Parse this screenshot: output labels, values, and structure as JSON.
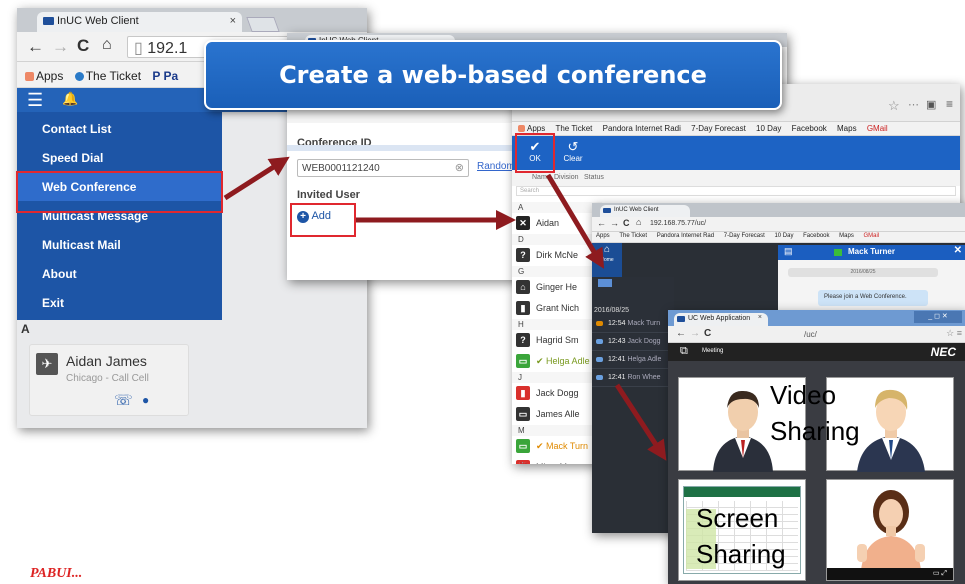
{
  "callout": {
    "title": "Create a web-based conference"
  },
  "window1": {
    "tab_title": "InUC Web Client",
    "tab_close": "×",
    "url": "192.1",
    "bookmarks": [
      "Apps",
      "The Ticket",
      "P Pa"
    ],
    "menu": [
      "Contact List",
      "Speed Dial",
      "Web Conference",
      "Multicast Message",
      "Multicast Mail",
      "About",
      "Exit"
    ],
    "section_letter": "A",
    "contact": {
      "name": "Aidan James",
      "location": "Chicago - Call Cell"
    }
  },
  "window2": {
    "tab_title": "InUC Web Client",
    "conference_id_label": "Conference ID",
    "conference_id_value": "WEB0001121240",
    "random_link": "Random",
    "invited_user_label": "Invited User",
    "add_button": "Add"
  },
  "window3": {
    "bookmarks": [
      "Apps",
      "The Ticket",
      "Pandora Internet Radi",
      "7-Day Forecast",
      "10 Day",
      "Facebook",
      "Maps",
      "GMail"
    ],
    "ok_label": "OK",
    "clear_label": "Clear",
    "filter_tabs": [
      "Name",
      "Division",
      "Status"
    ],
    "search_placeholder": "Search",
    "contacts": [
      {
        "type": "section",
        "label": "A"
      },
      {
        "type": "contact",
        "name": "Aidan",
        "color": "#222222",
        "glyph": "✕"
      },
      {
        "type": "section",
        "label": "D"
      },
      {
        "type": "contact",
        "name": "Dirk McNe",
        "color": "#333333",
        "glyph": "?"
      },
      {
        "type": "section",
        "label": "G"
      },
      {
        "type": "contact",
        "name": "Ginger He",
        "color": "#333333",
        "glyph": "⌂"
      },
      {
        "type": "contact",
        "name": "Grant Nich",
        "color": "#333333",
        "glyph": "▮"
      },
      {
        "type": "section",
        "label": "H"
      },
      {
        "type": "contact",
        "name": "Hagrid Sm",
        "color": "#333333",
        "glyph": "?"
      },
      {
        "type": "contact",
        "name": "✔ Helga Adle",
        "color": "#3aa53a",
        "glyph": "▭",
        "highlight": "#7a9a20"
      },
      {
        "type": "section",
        "label": "J"
      },
      {
        "type": "contact",
        "name": "Jack Dogg",
        "color": "#d9302c",
        "glyph": "▮"
      },
      {
        "type": "contact",
        "name": "James Alle",
        "color": "#333333",
        "glyph": "▭"
      },
      {
        "type": "section",
        "label": "M"
      },
      {
        "type": "contact",
        "name": "✔ Mack Turn",
        "color": "#3aa53a",
        "glyph": "▭",
        "highlight": "#e08a00"
      },
      {
        "type": "contact",
        "name": "Misty May",
        "color": "#d9302c",
        "glyph": "⏰"
      }
    ]
  },
  "window4": {
    "tab_title": "InUC Web Client",
    "url": "192.168.75.77/uc/",
    "bookmarks": [
      "Apps",
      "The Ticket",
      "Pandora Internet Rad",
      "7-Day Forecast",
      "10 Day",
      "Facebook",
      "Maps",
      "GMail"
    ],
    "home_label": "Home",
    "date_header": "2016/08/25",
    "chat_partner": "Mack Turner",
    "chat_date": "2016/08/25",
    "chat_message": "Please join a Web Conference.",
    "feed": [
      {
        "time": "12:54",
        "name": "Mack Turn"
      },
      {
        "time": "12:43",
        "name": "Jack Dogg"
      },
      {
        "time": "12:41",
        "name": "Helga Adle"
      },
      {
        "time": "12:41",
        "name": "Ron Whee"
      }
    ]
  },
  "window5": {
    "tab_title": "UC Web Application",
    "url": "/uc/",
    "meeting_label": "Meeting",
    "brand": "NEC",
    "video_label_1": "Video",
    "video_label_2": "Sharing",
    "screen_label_1": "Screen",
    "screen_label_2": "Sharing"
  },
  "footer": {
    "partial_text": "PABUI..."
  }
}
